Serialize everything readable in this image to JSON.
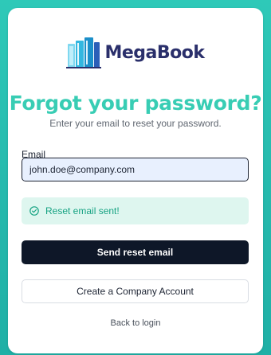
{
  "brand": {
    "name": "MegaBook",
    "logo_icon": "book-stack-icon",
    "colors": {
      "background": "#2ec9b8",
      "title": "#38cdb4",
      "brand_text": "#2a2f6b",
      "primary_button": "#0e1728",
      "success_bg": "#def6ef",
      "success_text": "#17a383"
    }
  },
  "form": {
    "title": "Forgot your password?",
    "subtitle": "Enter your email to reset your password.",
    "email_label": "Email",
    "email_value": "john.doe@company.com"
  },
  "alert": {
    "icon": "check-circle-icon",
    "message": "Reset email sent!"
  },
  "actions": {
    "send_reset": "Send reset email",
    "create_account": "Create a Company Account",
    "back_to_login": "Back to login"
  }
}
